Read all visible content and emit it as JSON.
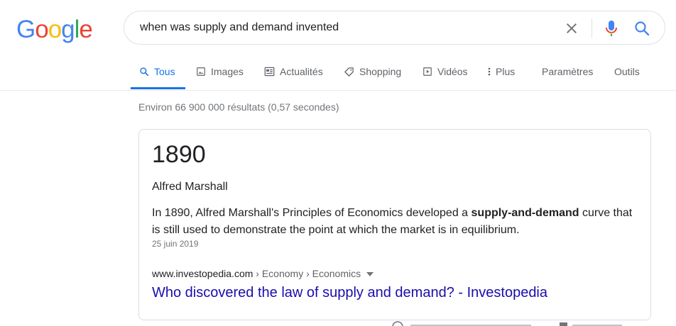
{
  "logo": {
    "letters": [
      "G",
      "o",
      "o",
      "g",
      "l",
      "e"
    ],
    "colors": [
      "#4285f4",
      "#ea4335",
      "#fbbc05",
      "#4285f4",
      "#34a853",
      "#ea4335"
    ]
  },
  "search": {
    "query": "when was supply and demand invented"
  },
  "tabs": [
    {
      "label": "Tous",
      "icon": "search-icon",
      "active": true
    },
    {
      "label": "Images",
      "icon": "image-icon",
      "active": false
    },
    {
      "label": "Actualités",
      "icon": "news-icon",
      "active": false
    },
    {
      "label": "Shopping",
      "icon": "tag-icon",
      "active": false
    },
    {
      "label": "Vidéos",
      "icon": "play-icon",
      "active": false
    },
    {
      "label": "Plus",
      "icon": "more-vert-icon",
      "active": false
    }
  ],
  "tools": {
    "settings": "Paramètres",
    "tools": "Outils"
  },
  "stats": "Environ 66 900 000 résultats (0,57 secondes)",
  "featured": {
    "answer": "1890",
    "entity": "Alfred Marshall",
    "snippet_pre": "In 1890, Alfred Marshall's Principles of Economics developed a ",
    "snippet_bold": "supply-and-demand",
    "snippet_post": " curve that is still used to demonstrate the point at which the market is in equilibrium.",
    "date": "25 juin 2019",
    "cite_domain": "www.investopedia.com",
    "cite_crumbs": " › Economy › Economics",
    "link_title": "Who discovered the law of supply and demand? - Investopedia"
  },
  "colors": {
    "accent": "#1a73e8",
    "link": "#1a0dab",
    "muted": "#70757a"
  }
}
